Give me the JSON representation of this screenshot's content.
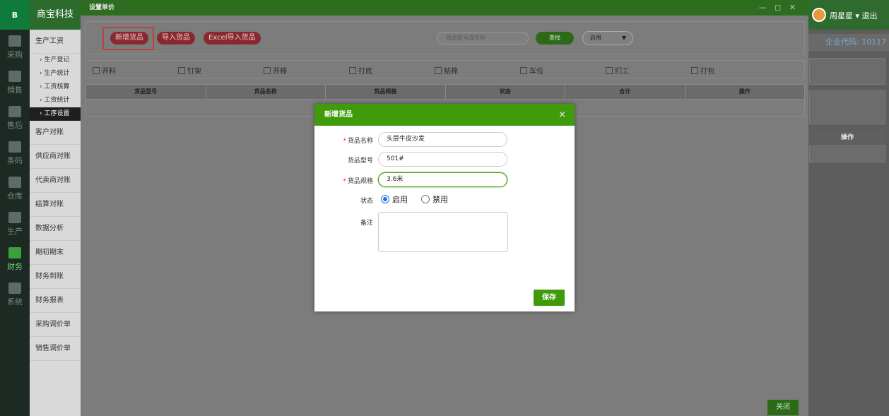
{
  "rail": {
    "logo": "B",
    "items": [
      {
        "label": "采购",
        "active": false
      },
      {
        "label": "销售",
        "active": false
      },
      {
        "label": "售后",
        "active": false
      },
      {
        "label": "条码",
        "active": false
      },
      {
        "label": "仓库",
        "active": false
      },
      {
        "label": "生产",
        "active": false
      },
      {
        "label": "财务",
        "active": true
      },
      {
        "label": "系统",
        "active": false
      }
    ]
  },
  "menu": {
    "brand": "商宝科技",
    "top_item": "生产工资",
    "subs": [
      "生产登记",
      "生产统计",
      "工资核算",
      "工资统计",
      "工序设置"
    ],
    "items": [
      "客户对账",
      "供应商对账",
      "代卖商对账",
      "结算对账",
      "数据分析",
      "期初期末",
      "财务到账",
      "财务报表",
      "采购调价单",
      "销售调价单"
    ]
  },
  "header": {
    "user": "周星星 ▾",
    "logout": "退出",
    "company_code": "企业代码: 10117",
    "bg_op": "操作"
  },
  "window": {
    "title": "设置单价",
    "controls": "— ◻ ✕",
    "toolbar": {
      "add_label": "新增货品",
      "import_label": "导入货品",
      "excel_label": "Excel导入货品",
      "search_placeholder": "货品型号或名称",
      "search_button": "查找",
      "status_select": "启用",
      "select_arrow": "▼"
    },
    "checkboxes": [
      "开料",
      "钉架",
      "开棉",
      "打底",
      "贴棉",
      "车位",
      "扪工",
      "打包"
    ],
    "columns": [
      "货品型号",
      "货品名称",
      "货品规格",
      "状态",
      "合计",
      "操作"
    ],
    "close_button": "关闭"
  },
  "modal": {
    "title": "新增货品",
    "close_icon": "×",
    "fields": {
      "name": {
        "label": "货品名称",
        "required": true,
        "value": "头层牛皮沙发"
      },
      "model": {
        "label": "货品型号",
        "required": false,
        "value": "501#"
      },
      "spec": {
        "label": "货品规格",
        "required": true,
        "value": "3.6米"
      },
      "status": {
        "label": "状态",
        "options": [
          "启用",
          "禁用"
        ],
        "selected": "启用"
      },
      "remark": {
        "label": "备注",
        "value": ""
      }
    },
    "save_button": "保存"
  }
}
